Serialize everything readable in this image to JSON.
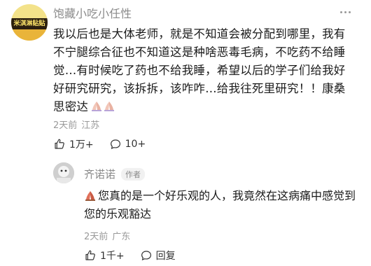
{
  "comment": {
    "avatar_text": "米淇淋贴贴",
    "username": "饱藏小吃小任性",
    "text": "我以后也是大体老师，就是不知道会被分配到哪里，我有不宁腿综合征也不知道这是种啥恶毒毛病，不吃药不给睡觉…有时候吃了药也不给我睡，希望以后的学子们给我好好研究研究，该拆拆，该咋咋…给我往死里研究！！康桑思密达",
    "emoji": "folded-hands",
    "time": "2天前",
    "location": "江苏",
    "likes": "1万+",
    "replies": "10+"
  },
  "reply": {
    "username": "齐诺诺",
    "badge": "作者",
    "text": "您真的是一个好乐观的人，我竟然在这病痛中感觉到您的乐观豁达",
    "emoji": "folded-hands",
    "time": "2天前",
    "location": "广东",
    "likes": "1千+",
    "reply_label": "回复"
  }
}
